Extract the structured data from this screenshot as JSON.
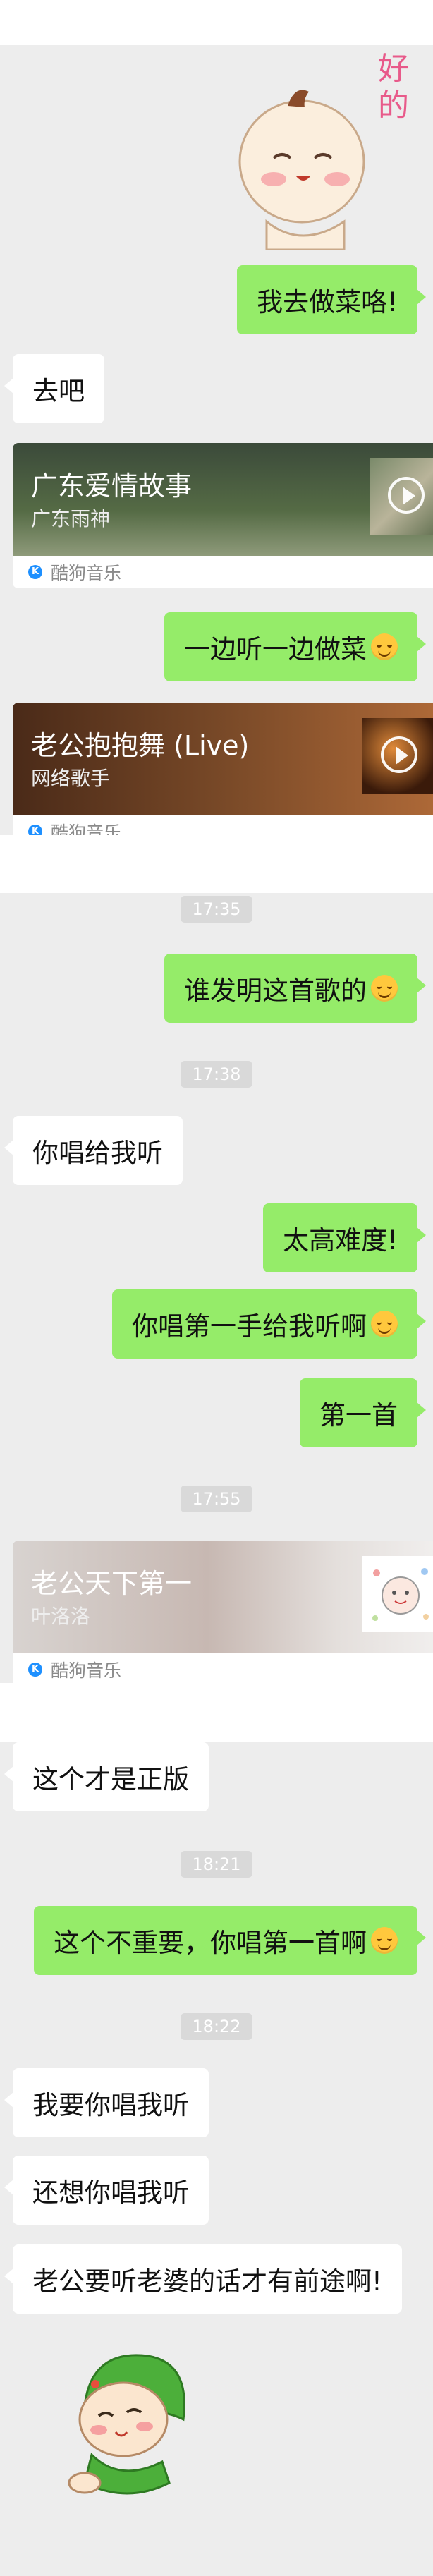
{
  "messages": {
    "m1": "我去做菜咯!",
    "m2": "去吧",
    "m3": "一边听一边做菜",
    "m4": "谁发明这首歌的",
    "m5": "你唱给我听",
    "m6": "太高难度!",
    "m7": "你唱第一手给我听啊",
    "m8": "第一首",
    "m9": "这个才是正版",
    "m10": "这个不重要，你唱第一首啊",
    "m11": "我要你唱我听",
    "m12": "还想你唱我听",
    "m13": "老公要听老婆的话才有前途啊!"
  },
  "times": [
    "17:35",
    "17:38",
    "17:55",
    "18:21",
    "18:22"
  ],
  "sticker1_text": [
    "好",
    "的"
  ],
  "music_cards": [
    {
      "title": "广东爱情故事",
      "artist": "广东雨神",
      "source": "酷狗音乐"
    },
    {
      "title": "老公抱抱舞 (Live)",
      "artist": "网络歌手",
      "source": "酷狗音乐"
    },
    {
      "title": "老公天下第一",
      "artist": "叶洛洛",
      "source": "酷狗音乐"
    }
  ],
  "colors": {
    "chat_bg": "#ededed",
    "out_bubble": "#95ec69",
    "in_bubble": "#ffffff",
    "kugou": "#1e90ff"
  },
  "icons": [
    "play-icon",
    "kugou-icon",
    "smile-emoji",
    "laughing-emoji",
    "grin-emoji"
  ]
}
